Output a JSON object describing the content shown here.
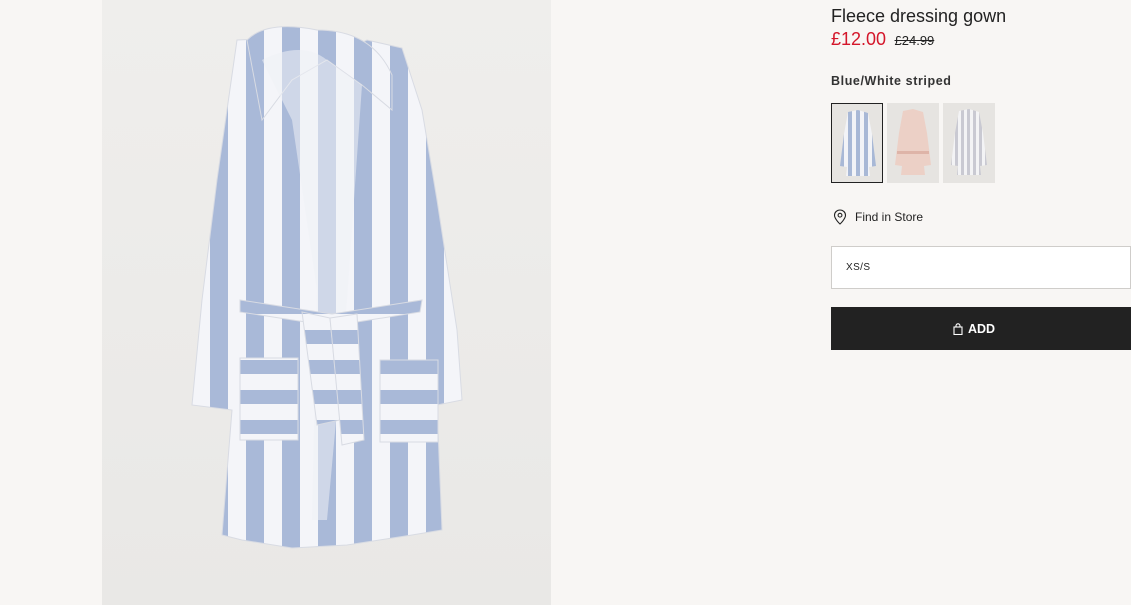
{
  "product": {
    "title": "Fleece dressing gown",
    "price_sale": "£12.00",
    "price_original": "£24.99",
    "color_name": "Blue/White striped",
    "swatches": [
      {
        "name": "Blue/White striped",
        "stripe_color": "#a8b8d6",
        "base_color": "#f2f3f7"
      },
      {
        "name": "Pink",
        "stripe_color": "#e6c2b8",
        "base_color": "#ecd3cb"
      },
      {
        "name": "White/Grey striped",
        "stripe_color": "#c9c9d2",
        "base_color": "#f3f3f5"
      }
    ],
    "selected_swatch_index": 0
  },
  "store": {
    "find_label": "Find in Store",
    "icon": "location-pin-icon"
  },
  "size": {
    "selected": "XS/S"
  },
  "cart": {
    "add_label": "ADD",
    "icon": "shopping-bag-icon"
  },
  "colors": {
    "sale_price": "#d4162a",
    "add_button_bg": "#222222",
    "page_bg": "#f8f6f4",
    "robe_stripe": "#a9b9d8",
    "robe_base": "#f4f5f9"
  }
}
